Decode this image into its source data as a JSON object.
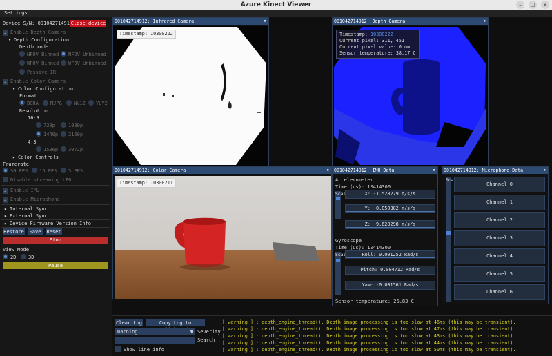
{
  "window": {
    "title": "Azure Kinect Viewer",
    "buttons": [
      "–",
      "□",
      "×"
    ]
  },
  "menubar": {
    "settings": "Settings"
  },
  "sidebar": {
    "device_label": "Device S/N: 001042714912",
    "close_device": "Close device",
    "enable_depth": "Enable Depth Camera",
    "depth_config": "Depth Configuration",
    "depth_mode": "Depth mode",
    "nfov_binned": "NFOV Binned",
    "nfov_unbinned": "NFOV Unbinned",
    "wfov_binned": "WFOV Binned",
    "wfov_unbinned": "WFOV Unbinned",
    "passive_ir": "Passive IR",
    "enable_color": "Enable Color Camera",
    "color_config": "Color Configuration",
    "format": "Format",
    "bgra": "BGRA",
    "mjpg": "MJPG",
    "nv12": "NV12",
    "yuy2": "YUY2",
    "resolution": "Resolution",
    "ratio_16_9": "16:9",
    "r720": "720p",
    "r1080": "1080p",
    "r1440": "1440p",
    "r2160": "2160p",
    "ratio_4_3": "4:3",
    "r1536": "1536p",
    "r3072": "3072p",
    "color_controls": "Color Controls",
    "framerate": "Framerate",
    "fps30": "30 FPS",
    "fps15": "15 FPS",
    "fps5": "5 FPS",
    "disable_led": "Disable streaming LED",
    "enable_imu": "Enable IMU",
    "enable_mic": "Enable Microphone",
    "internal_sync": "Internal Sync",
    "external_sync": "External Sync",
    "firmware": "Device Firmware Version Info",
    "restore": "Restore",
    "save": "Save",
    "reset": "Reset",
    "stop": "Stop",
    "view_mode": "View Mode",
    "mode_2d": "2D",
    "mode_3d": "3D",
    "pause": "Pause"
  },
  "infrared": {
    "title": "001042714912: Infrared Camera",
    "timestamp_label": "Timestamp: ",
    "timestamp": "10300222"
  },
  "depth": {
    "title": "001042714912: Depth Camera",
    "timestamp_label": "Timestamp: ",
    "timestamp": "10300222",
    "pixel": "Current pixel: 311, 451",
    "pixel_value": "Current pixel value: 0 mm",
    "sensor_temp": "Sensor temperature: 38.17 C"
  },
  "color": {
    "title": "001042714912: Color Camera",
    "timestamp_label": "Timestamp: ",
    "timestamp": "10300211"
  },
  "imu": {
    "title": "001042714912: IMU Data",
    "accel": "Accelerometer",
    "accel_time": "Time (us): 10414300",
    "ax": "X:  -1.528279 m/s/s",
    "ay": "Y:  -0.050382 m/s/s",
    "az": "Z:  -9.628298 m/s/s",
    "gyro": "Gyroscope",
    "gyro_time": "Time (us): 10414300",
    "roll": "Roll:   0.001252 Rad/s",
    "pitch": "Pitch:   0.004712 Rad/s",
    "yaw": "Yaw:  -0.001561 Rad/s",
    "sensor_temp": "Sensor temperature: 26.83 C",
    "scale": "Scale"
  },
  "mic": {
    "title": "001042714912: Microphone Data",
    "scale": "Scale",
    "channels": [
      "Channel 0",
      "Channel 1",
      "Channel 2",
      "Channel 3",
      "Channel 4",
      "Channel 5",
      "Channel 6"
    ]
  },
  "log": {
    "clear": "Clear Log",
    "copy": "Copy Log to Clipboard",
    "severity_value": "Warning",
    "severity_label": "Severity",
    "search_label": "Search",
    "show_line_info": "Show line info",
    "lines": [
      "[ warning ] : depth_engine_thread(). Depth image processing is too slow at 46ms (this may be transient).",
      "[ warning ] : depth_engine_thread(). Depth image processing is too slow at 47ms (this may be transient).",
      "[ warning ] : depth_engine_thread(). Depth image processing is too slow at 43ms (this may be transient).",
      "[ warning ] : depth_engine_thread(). Depth image processing is too slow at 44ms (this may be transient).",
      "[ warning ] : depth_engine_thread(). Depth image processing is too slow at 50ms (this may be transient)."
    ]
  }
}
